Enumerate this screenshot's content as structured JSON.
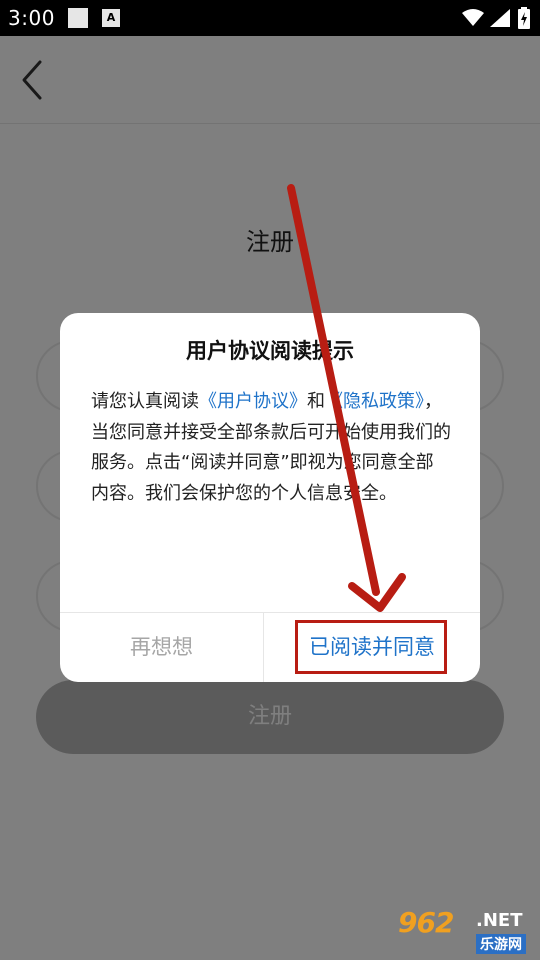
{
  "status_bar": {
    "time": "3:00",
    "notification_icon_letter": "A"
  },
  "page": {
    "title": "注册",
    "register_button": "注册"
  },
  "dialog": {
    "title": "用户协议阅读提示",
    "body_text_1": "请您认真阅读",
    "link_user_agreement": "《用户协议》",
    "body_text_2": "和",
    "link_privacy_policy": "《隐私政策》",
    "body_text_3": "，当您同意并接受全部条款后可开始使用我们的服务。点击“阅读并同意”即视为您同意全部内容。我们会保护您的个人信息安全。",
    "cancel_button": "再想想",
    "agree_button": "已阅读并同意"
  },
  "watermark": {
    "logo": "962",
    "domain": ".NET",
    "site_name": "乐游网"
  },
  "colors": {
    "link": "#1f73c9",
    "annotation_red": "#b81d13",
    "cancel_text": "#a6a6a6"
  },
  "icons": [
    "back-icon",
    "wifi-icon",
    "signal-icon",
    "battery-icon"
  ]
}
